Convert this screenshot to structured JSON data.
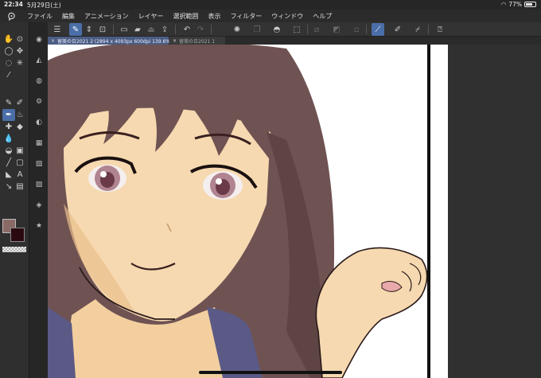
{
  "status": {
    "time": "22:34",
    "date": "5月29日(土)",
    "battery": "77%",
    "battery_level": 0.77
  },
  "menu": {
    "items": [
      "ファイル",
      "編集",
      "アニメーション",
      "レイヤー",
      "選択範囲",
      "表示",
      "フィルター",
      "ウィンドウ",
      "ヘルプ"
    ]
  },
  "tabs": [
    {
      "label": "留美の日2021 2 (2894 x 4093px 600dpi 139.6%)",
      "active": true
    },
    {
      "label": "留美の日2021 1",
      "active": false
    }
  ],
  "colors": {
    "main_color": "#8a6a66",
    "sub_color": "#2a0a10",
    "accent": "#4a6ea8",
    "skin": "#f6d9b0",
    "hair": "#6f5252",
    "uniform": "#5b5a86"
  },
  "icons": {
    "menu": "hamburger-icon",
    "selected_tool": "pen-icon"
  }
}
